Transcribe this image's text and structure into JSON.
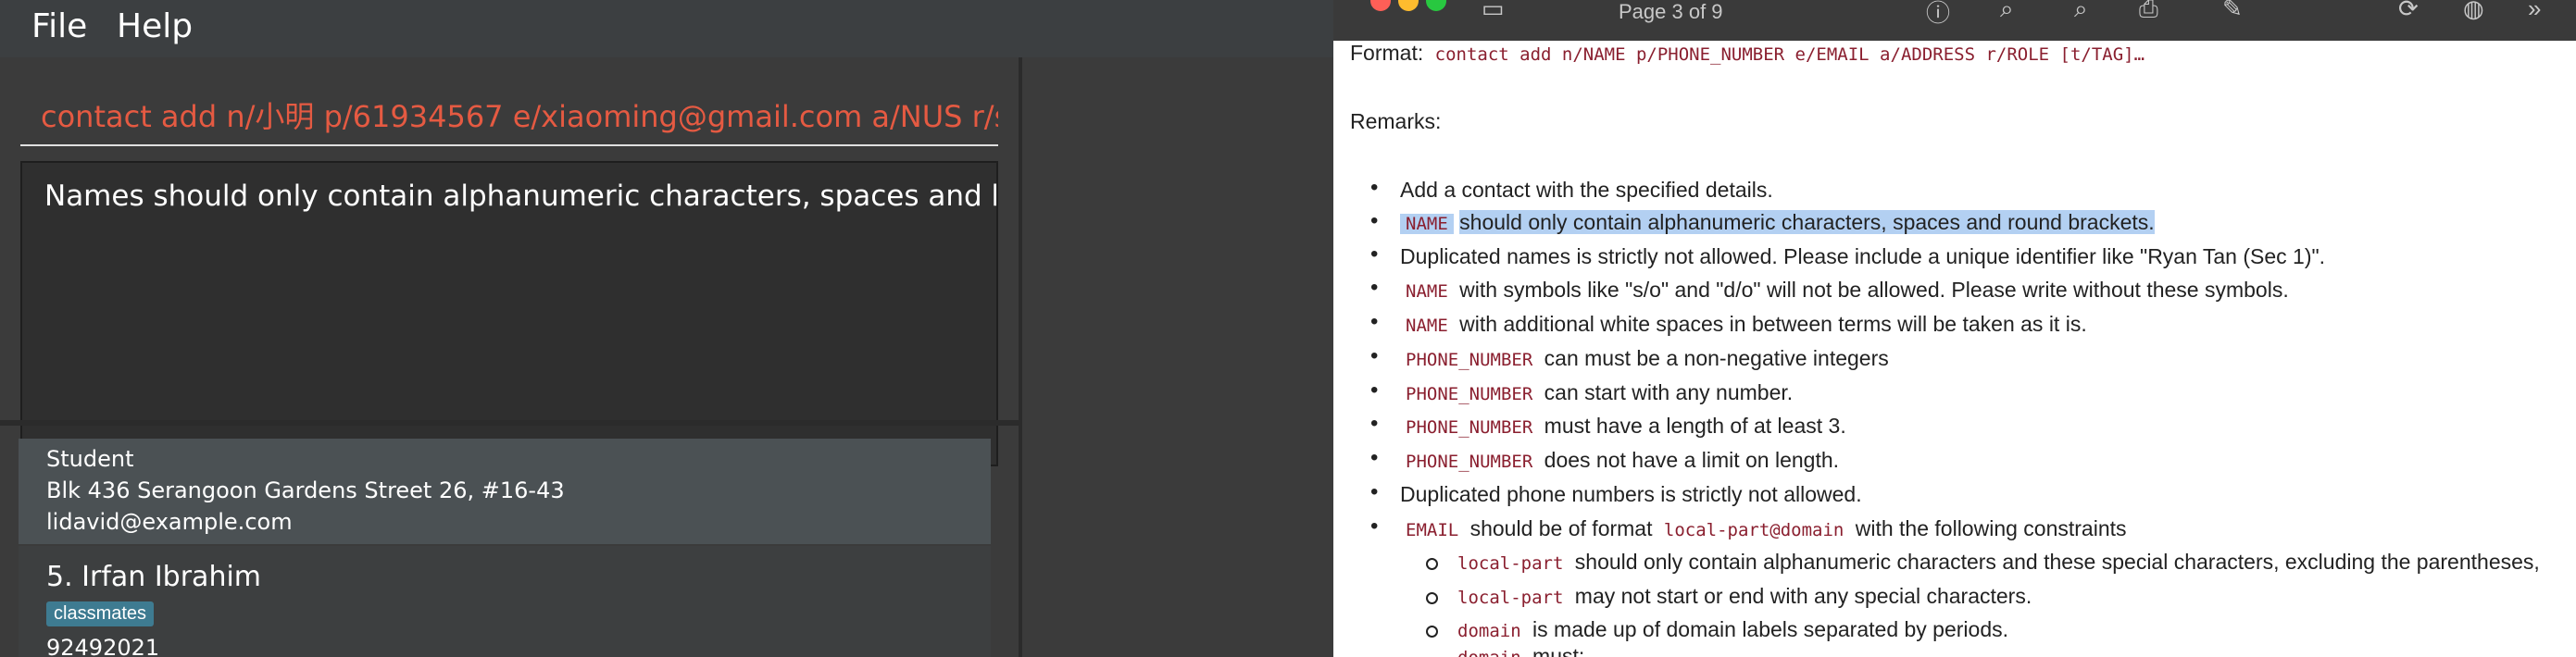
{
  "app": {
    "menu": {
      "file": "File",
      "help": "Help"
    },
    "command_input": "contact add n/小明 p/61934567 e/xiaoming@gmail.com a/NUS r/stud",
    "result_text": "Names should only contain alphanumeric characters, spaces and bracke",
    "cards": [
      {
        "role": "Student",
        "address": "Blk 436 Serangoon Gardens Street 26, #16-43",
        "email": "lidavid@example.com"
      },
      {
        "name": "5. Irfan Ibrahim",
        "tag": "classmates",
        "phone": "92492021"
      }
    ]
  },
  "viewer": {
    "page_indicator": "Page 3 of 9",
    "format_label": "Format:",
    "format_code": "contact add n/NAME p/PHONE_NUMBER e/EMAIL a/ADDRESS r/ROLE [t/TAG]…",
    "remarks_label": "Remarks:",
    "bullets": [
      {
        "text": "Add a contact with the specified details."
      },
      {
        "code": "NAME",
        "text": "should only contain alphanumeric characters, spaces and round brackets."
      },
      {
        "text": "Duplicated names is strictly not allowed. Please include a unique identifier like \"Ryan Tan (Sec 1)\"."
      },
      {
        "code": "NAME",
        "text": "with symbols like \"s/o\" and \"d/o\" will not be allowed. Please write without these symbols."
      },
      {
        "code": "NAME",
        "text": "with additional white spaces in between terms will be taken as it is."
      },
      {
        "code": "PHONE_NUMBER",
        "text": "can must be a non-negative integers"
      },
      {
        "code": "PHONE_NUMBER",
        "text": "can start with any number."
      },
      {
        "code": "PHONE_NUMBER",
        "text": "must have a length of at least 3."
      },
      {
        "code": "PHONE_NUMBER",
        "text": "does not have a limit on length."
      },
      {
        "text": "Duplicated phone numbers is strictly not allowed."
      },
      {
        "code": "EMAIL",
        "text": "should be of format",
        "code2": "local-part@domain",
        "text2": "with the following constraints"
      }
    ],
    "sub_bullets": [
      {
        "code": "local-part",
        "text": "should only contain alphanumeric characters and these special characters, excluding the parentheses,"
      },
      {
        "code": "local-part",
        "text": "may not start or end with any special characters."
      },
      {
        "code": "domain",
        "text": "is made up of domain labels separated by periods."
      },
      {
        "code": "domain",
        "text": "must:"
      }
    ]
  }
}
